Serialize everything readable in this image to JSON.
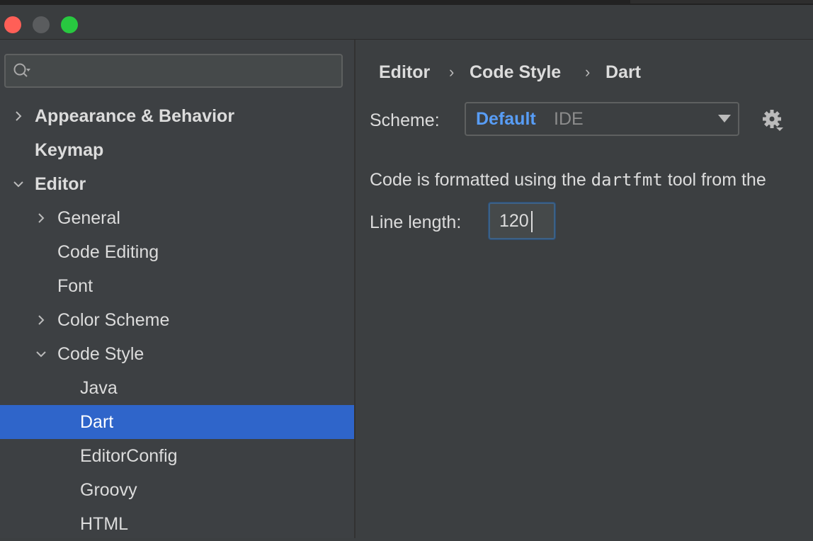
{
  "window": {
    "controls": [
      "close",
      "minimize",
      "maximize"
    ]
  },
  "sidebar": {
    "search": {
      "placeholder": "",
      "icon": "search-icon"
    },
    "items": [
      {
        "label": "Appearance & Behavior",
        "chevron": "right",
        "level": 0,
        "bold": true
      },
      {
        "label": "Keymap",
        "chevron": "none",
        "level": 0,
        "bold": true
      },
      {
        "label": "Editor",
        "chevron": "down",
        "level": 0,
        "bold": true
      },
      {
        "label": "General",
        "chevron": "right",
        "level": 1,
        "bold": false
      },
      {
        "label": "Code Editing",
        "chevron": "none",
        "level": 1,
        "bold": false
      },
      {
        "label": "Font",
        "chevron": "none",
        "level": 1,
        "bold": false
      },
      {
        "label": "Color Scheme",
        "chevron": "right",
        "level": 1,
        "bold": false
      },
      {
        "label": "Code Style",
        "chevron": "down",
        "level": 1,
        "bold": false
      },
      {
        "label": "Java",
        "chevron": "none",
        "level": 2,
        "bold": false
      },
      {
        "label": "Dart",
        "chevron": "none",
        "level": 2,
        "bold": false,
        "selected": true
      },
      {
        "label": "EditorConfig",
        "chevron": "none",
        "level": 2,
        "bold": false
      },
      {
        "label": "Groovy",
        "chevron": "none",
        "level": 2,
        "bold": false
      },
      {
        "label": "HTML",
        "chevron": "none",
        "level": 2,
        "bold": false
      }
    ]
  },
  "breadcrumb": {
    "items": [
      "Editor",
      "Code Style",
      "Dart"
    ],
    "separator": "›"
  },
  "scheme": {
    "label": "Scheme:",
    "value": "Default",
    "sub": "IDE"
  },
  "description": {
    "prefix": "Code is formatted using the ",
    "tool": "dartfmt",
    "suffix": " tool from the"
  },
  "line_length": {
    "label": "Line length:",
    "value": "120"
  },
  "colors": {
    "selection": "#2f65ca",
    "scheme_value": "#589df6",
    "close": "#ff5f57",
    "maximize": "#28c840"
  }
}
